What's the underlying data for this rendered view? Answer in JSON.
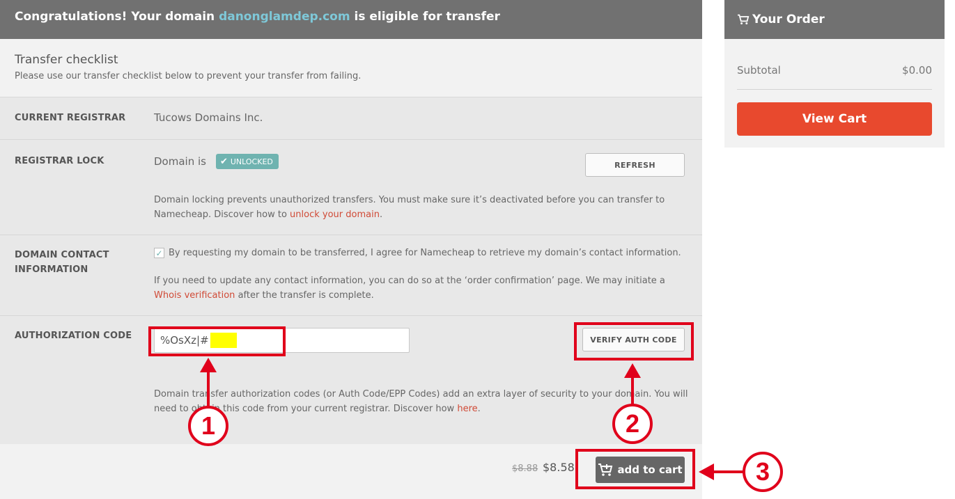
{
  "banner": {
    "prefix": "Congratulations! Your domain",
    "domain": "danonglamdep.com",
    "suffix": "is eligible for transfer"
  },
  "checklist": {
    "title": "Transfer checklist",
    "subtitle": "Please use our transfer checklist below to prevent your transfer from failing."
  },
  "current_registrar": {
    "label": "CURRENT REGISTRAR",
    "value": "Tucows Domains Inc."
  },
  "registrar_lock": {
    "label": "REGISTRAR LOCK",
    "status_prefix": "Domain is",
    "badge": "UNLOCKED",
    "refresh_label": "REFRESH",
    "desc": "Domain locking prevents unauthorized transfers. You must make sure it’s deactivated before you can transfer to Namecheap. Discover how to",
    "link": "unlock your domain",
    "desc_end": "."
  },
  "contact": {
    "label_line1": "DOMAIN CONTACT",
    "label_line2": "INFORMATION",
    "consent": "By requesting my domain to be transferred, I agree for Namecheap to retrieve my domain’s contact information.",
    "desc": "If you need to update any contact information, you can do so at the ‘order confirmation’ page. We may initiate a",
    "link": "Whois verification",
    "desc_end": "after the transfer is complete."
  },
  "auth": {
    "label": "AUTHORIZATION CODE",
    "value": "%OsXz|#",
    "verify_label": "VERIFY AUTH CODE",
    "desc": "Domain transfer authorization codes (or Auth Code/EPP Codes) add an extra layer of security to your domain. You will need to obtain this code from your current registrar. Discover how",
    "link": "here",
    "desc_end": "."
  },
  "footer": {
    "old_price": "$8.88",
    "new_price": "$8.58",
    "add_to_cart": "add to cart"
  },
  "order": {
    "title": "Your Order",
    "subtotal_label": "Subtotal",
    "subtotal_value": "$0.00",
    "view_cart": "View Cart"
  },
  "annotations": {
    "step1": "1",
    "step2": "2",
    "step3": "3",
    "color": "#e0001b"
  },
  "icons": {
    "cart": "cart-icon",
    "check": "check-icon"
  }
}
